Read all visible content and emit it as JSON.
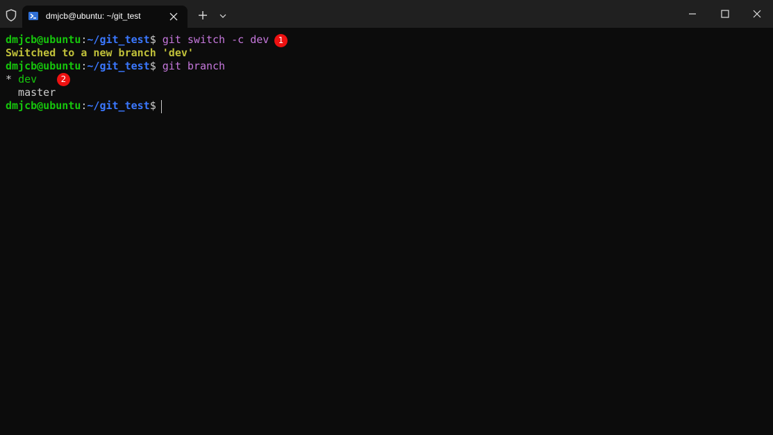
{
  "window": {
    "tab_title": "dmjcb@ubuntu: ~/git_test",
    "icons": {
      "shield": "shield-icon",
      "tab": "powershell-icon",
      "close_tab": "close-icon",
      "new_tab": "plus-icon",
      "dropdown": "chevron-down-icon",
      "minimize": "minimize-icon",
      "maximize": "maximize-icon",
      "close_window": "close-icon"
    }
  },
  "terminal": {
    "prompt": {
      "user": "dmjcb@ubuntu",
      "colon": ":",
      "path": "~/git_test",
      "dollar": "$"
    },
    "lines": [
      {
        "command": " git switch -c dev"
      },
      {
        "output": "Switched to a new branch 'dev'"
      },
      {
        "command": " git branch"
      },
      {
        "marker": "* ",
        "branch": "dev"
      },
      {
        "branch": "  master"
      },
      {
        "command": " "
      }
    ]
  },
  "annotations": {
    "badge_1": "1",
    "badge_2": "2"
  },
  "colors": {
    "background": "#0c0c0c",
    "titlebar": "#202020",
    "user": "#16c60c",
    "path": "#3b78ff",
    "command": "#c678dd",
    "output": "#c1c13a",
    "badge": "#ee1111"
  }
}
